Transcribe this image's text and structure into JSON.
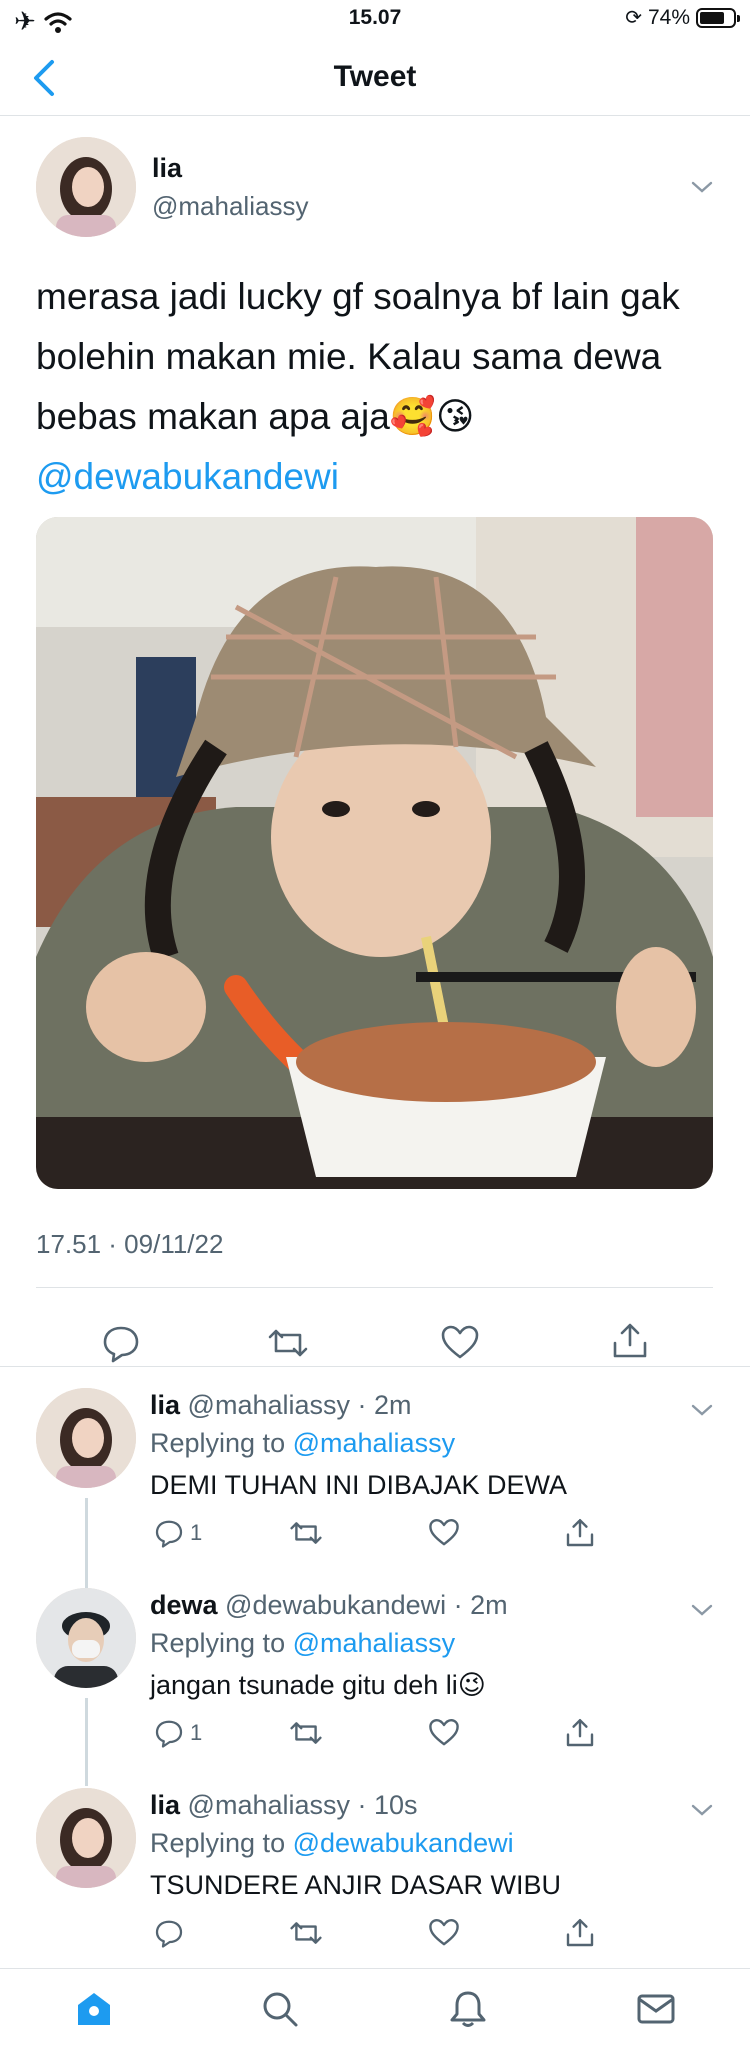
{
  "status_bar": {
    "time": "15.07",
    "battery": "74%",
    "battery_level": 0.74
  },
  "nav": {
    "title": "Tweet",
    "back_icon": "chevron-left-icon"
  },
  "tweet": {
    "name": "lia",
    "handle": "@mahaliassy",
    "text": "merasa jadi lucky gf soalnya bf lain gak bolehin makan mie. Kalau sama dewa bebas makan apa aja🥰😘",
    "mention": "@dewabukandewi",
    "timestamp": "17.51 · 09/11/22"
  },
  "replies": [
    {
      "name": "lia",
      "meta": "@mahaliassy · 2m",
      "replying_label": "Replying to",
      "replying_to": "@mahaliassy",
      "text": "DEMI TUHAN INI DIBAJAK DEWA",
      "reply_count": "1"
    },
    {
      "name": "dewa",
      "meta": "@dewabukandewi · 2m",
      "replying_label": "Replying to",
      "replying_to": "@mahaliassy",
      "text": "jangan tsunade gitu deh li😉",
      "reply_count": "1"
    },
    {
      "name": "lia",
      "meta": "@mahaliassy · 10s",
      "replying_label": "Replying to",
      "replying_to": "@dewabukandewi",
      "text": "TSUNDERE ANJIR DASAR WIBU",
      "reply_count": ""
    }
  ],
  "colors": {
    "accent": "#1d9bf0",
    "text": "#0f1419",
    "muted": "#536471",
    "divider": "#dfe3e6"
  }
}
